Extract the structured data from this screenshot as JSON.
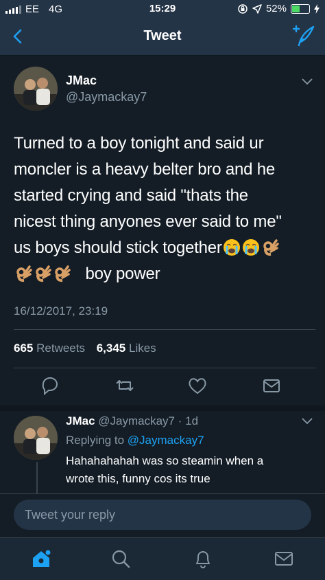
{
  "status_bar": {
    "carrier": "EE",
    "network": "4G",
    "time": "15:29",
    "battery_percent": "52%",
    "battery_level": 0.52
  },
  "nav": {
    "title": "Tweet"
  },
  "tweet": {
    "author_name": "JMac",
    "author_handle": "@Jaymackay7",
    "lines": [
      "Turned to a boy tonight and said ur",
      "moncler is a heavy belter bro and he",
      "started crying and said \"thats the",
      "nicest thing anyones ever said to me\"",
      "us boys should stick together",
      "boy power"
    ],
    "emojis_line5": [
      "crying-face",
      "crying-face",
      "ok-hand"
    ],
    "emojis_line6": [
      "ok-hand",
      "ok-hand",
      "ok-hand"
    ],
    "datetime": "16/12/2017, 23:19",
    "retweets_count": "665",
    "retweets_label": "Retweets",
    "likes_count": "6,345",
    "likes_label": "Likes"
  },
  "reply": {
    "author_name": "JMac",
    "author_handle": "@Jaymackay7",
    "age": "· 1d",
    "replying_prefix": "Replying to",
    "replying_to": "@Jaymackay7",
    "text_line1": "Hahahahahah was so steamin when a",
    "text_line2": "wrote this, funny cos its true"
  },
  "composer": {
    "placeholder": "Tweet your reply"
  },
  "colors": {
    "background": "#141d26",
    "bar": "#243447",
    "accent": "#1da1f2",
    "muted": "#8899a6"
  },
  "tabs": [
    "home-icon",
    "search-icon",
    "notifications-icon",
    "messages-icon"
  ]
}
